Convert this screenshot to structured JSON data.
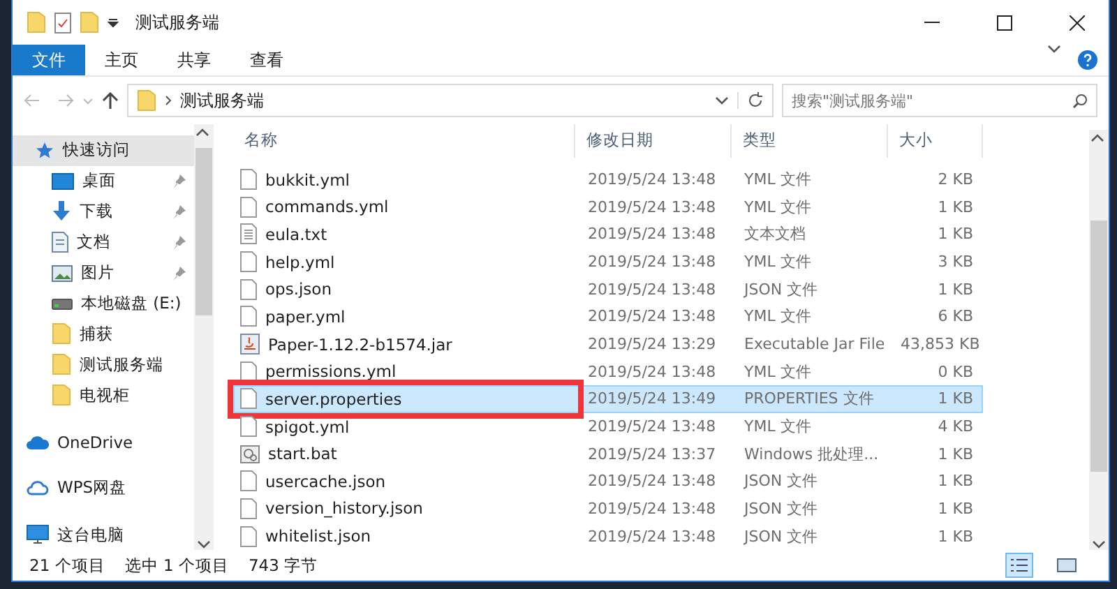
{
  "window": {
    "title": "测试服务端"
  },
  "ribbon_tabs": [
    {
      "label": "文件",
      "selected": true
    },
    {
      "label": "主页",
      "selected": false
    },
    {
      "label": "共享",
      "selected": false
    },
    {
      "label": "查看",
      "selected": false
    }
  ],
  "address": {
    "path": "测试服务端"
  },
  "search": {
    "placeholder": "搜索\"测试服务端\""
  },
  "sidebar": {
    "items": [
      {
        "label": "快速访问",
        "kind": "star",
        "selected": true,
        "pinned": false
      },
      {
        "label": "桌面",
        "kind": "desktop",
        "selected": false,
        "pinned": true
      },
      {
        "label": "下载",
        "kind": "download",
        "selected": false,
        "pinned": true
      },
      {
        "label": "文档",
        "kind": "document",
        "selected": false,
        "pinned": true
      },
      {
        "label": "图片",
        "kind": "picture",
        "selected": false,
        "pinned": true
      },
      {
        "label": "本地磁盘 (E:)",
        "kind": "drive",
        "selected": false,
        "pinned": false
      },
      {
        "label": "捕获",
        "kind": "folder",
        "selected": false,
        "pinned": false
      },
      {
        "label": "测试服务端",
        "kind": "folder",
        "selected": false,
        "pinned": false
      },
      {
        "label": "电视柜",
        "kind": "folder",
        "selected": false,
        "pinned": false
      },
      {
        "label": "OneDrive",
        "kind": "cloud",
        "selected": false,
        "pinned": false
      },
      {
        "label": "WPS网盘",
        "kind": "cloud_outline",
        "selected": false,
        "pinned": false
      },
      {
        "label": "这台电脑",
        "kind": "pc",
        "selected": false,
        "pinned": false
      }
    ]
  },
  "table": {
    "columns": [
      "名称",
      "修改日期",
      "类型",
      "大小"
    ],
    "rows": [
      {
        "name": "bukkit.yml",
        "date": "2019/5/24 13:48",
        "type": "YML 文件",
        "size": "2 KB",
        "kind": "file",
        "selected": false,
        "highlighted": false
      },
      {
        "name": "commands.yml",
        "date": "2019/5/24 13:48",
        "type": "YML 文件",
        "size": "1 KB",
        "kind": "file",
        "selected": false,
        "highlighted": false
      },
      {
        "name": "eula.txt",
        "date": "2019/5/24 13:48",
        "type": "文本文档",
        "size": "1 KB",
        "kind": "text",
        "selected": false,
        "highlighted": false
      },
      {
        "name": "help.yml",
        "date": "2019/5/24 13:48",
        "type": "YML 文件",
        "size": "3 KB",
        "kind": "file",
        "selected": false,
        "highlighted": false
      },
      {
        "name": "ops.json",
        "date": "2019/5/24 13:48",
        "type": "JSON 文件",
        "size": "1 KB",
        "kind": "file",
        "selected": false,
        "highlighted": false
      },
      {
        "name": "paper.yml",
        "date": "2019/5/24 13:48",
        "type": "YML 文件",
        "size": "6 KB",
        "kind": "file",
        "selected": false,
        "highlighted": false
      },
      {
        "name": "Paper-1.12.2-b1574.jar",
        "date": "2019/5/24 13:29",
        "type": "Executable Jar File",
        "size": "43,853 KB",
        "kind": "jar",
        "selected": false,
        "highlighted": false
      },
      {
        "name": "permissions.yml",
        "date": "2019/5/24 13:48",
        "type": "YML 文件",
        "size": "0 KB",
        "kind": "file",
        "selected": false,
        "highlighted": false
      },
      {
        "name": "server.properties",
        "date": "2019/5/24 13:49",
        "type": "PROPERTIES 文件",
        "size": "1 KB",
        "kind": "file",
        "selected": true,
        "highlighted": true
      },
      {
        "name": "spigot.yml",
        "date": "2019/5/24 13:48",
        "type": "YML 文件",
        "size": "4 KB",
        "kind": "file",
        "selected": false,
        "highlighted": false
      },
      {
        "name": "start.bat",
        "date": "2019/5/24 13:37",
        "type": "Windows 批处理...",
        "size": "1 KB",
        "kind": "bat",
        "selected": false,
        "highlighted": false
      },
      {
        "name": "usercache.json",
        "date": "2019/5/24 13:48",
        "type": "JSON 文件",
        "size": "1 KB",
        "kind": "file",
        "selected": false,
        "highlighted": false
      },
      {
        "name": "version_history.json",
        "date": "2019/5/24 13:48",
        "type": "JSON 文件",
        "size": "1 KB",
        "kind": "file",
        "selected": false,
        "highlighted": false
      },
      {
        "name": "whitelist.json",
        "date": "2019/5/24 13:48",
        "type": "JSON 文件",
        "size": "1 KB",
        "kind": "file",
        "selected": false,
        "highlighted": false
      }
    ]
  },
  "status_bar": {
    "count": "21 个项目",
    "selection": "选中 1 个项目",
    "size": "743 字节"
  },
  "view_buttons": [
    {
      "kind": "details",
      "selected": true
    },
    {
      "kind": "large_icons",
      "selected": false
    }
  ]
}
